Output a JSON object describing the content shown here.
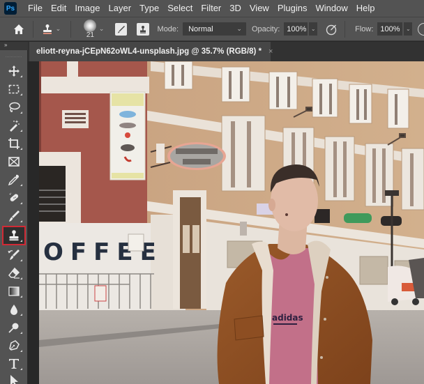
{
  "app": {
    "logo": "Ps",
    "menu": [
      "File",
      "Edit",
      "Image",
      "Layer",
      "Type",
      "Select",
      "Filter",
      "3D",
      "View",
      "Plugins",
      "Window",
      "Help"
    ]
  },
  "options_bar": {
    "home_icon": "home-icon",
    "tool_preset_icon": "clone-stamp-icon",
    "brush_size": "21",
    "toggle_brush_panel_icon": "brush-settings-icon",
    "toggle_clone_source_icon": "clone-source-icon",
    "mode_label": "Mode:",
    "mode_value": "Normal",
    "opacity_label": "Opacity:",
    "opacity_value": "100%",
    "pressure_opacity_icon": "pressure-opacity-icon",
    "flow_label": "Flow:",
    "flow_value": "100%"
  },
  "toolbar": {
    "collapse_label": "»",
    "active_tool": "clone-stamp",
    "active_color": "#d12a35",
    "tools": [
      {
        "name": "move-tool",
        "icon": "move-icon"
      },
      {
        "name": "rectangular-marquee-tool",
        "icon": "marquee-icon"
      },
      {
        "name": "lasso-tool",
        "icon": "lasso-icon"
      },
      {
        "name": "magic-wand-tool",
        "icon": "magic-wand-icon"
      },
      {
        "name": "crop-tool",
        "icon": "crop-icon"
      },
      {
        "name": "frame-tool",
        "icon": "frame-icon"
      },
      {
        "name": "eyedropper-tool",
        "icon": "eyedropper-icon"
      },
      {
        "name": "healing-brush-tool",
        "icon": "bandage-icon"
      },
      {
        "name": "brush-tool",
        "icon": "brush-icon"
      },
      {
        "name": "clone-stamp-tool",
        "icon": "clone-stamp-icon"
      },
      {
        "name": "history-brush-tool",
        "icon": "history-brush-icon"
      },
      {
        "name": "eraser-tool",
        "icon": "eraser-icon"
      },
      {
        "name": "gradient-tool",
        "icon": "gradient-icon"
      },
      {
        "name": "blur-tool",
        "icon": "blur-drop-icon"
      },
      {
        "name": "dodge-tool",
        "icon": "dodge-icon"
      },
      {
        "name": "pen-tool",
        "icon": "pen-icon"
      },
      {
        "name": "type-tool",
        "icon": "type-icon"
      },
      {
        "name": "path-selection-tool",
        "icon": "arrow-icon"
      }
    ]
  },
  "document": {
    "tab_title": "eliott-reyna-jCEpN62oWL4-unsplash.jpg @ 35.7% (RGB/8) *",
    "close_glyph": "×",
    "filename": "eliott-reyna-jCEpN62oWL4-unsplash.jpg",
    "zoom": "35.7%",
    "color_mode": "RGB/8",
    "unsaved": true
  },
  "photo": {
    "description": "Man in brown jacket and pink adidas t-shirt on a street in front of brick buildings",
    "sign_coffee": "OFFEE",
    "shirt_text": "adidas",
    "colors": {
      "brick_red": "#a5574c",
      "brick_tan": "#c9a482",
      "trim_white": "#ece6df",
      "jacket": "#8e4f22",
      "shirt": "#c27089",
      "road": "#a8a39f"
    }
  }
}
